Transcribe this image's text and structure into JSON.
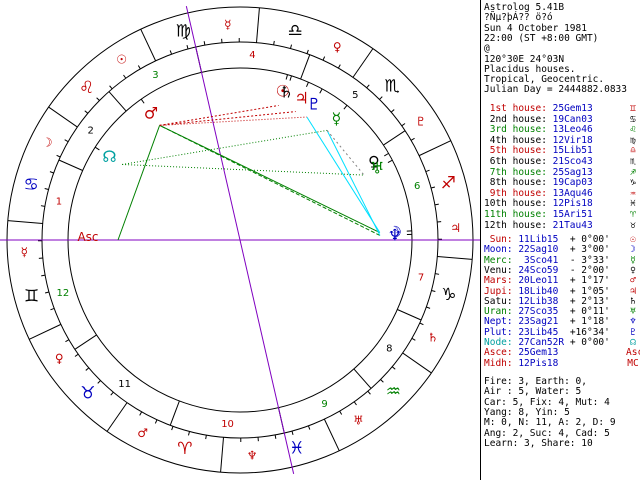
{
  "header": [
    "Astrolog 5.41B",
    "?Ñµ?þÁ?? ö?ó",
    "Sun 4 October 1981",
    "22:00 (ST +8:00 GMT)",
    "@",
    "120°30E 24°03N",
    "Placidus houses.",
    "Tropical, Geocentric.",
    "Julian Day = 2444882.0833"
  ],
  "houses": [
    {
      "label": "1st house:",
      "value": "25Gem13",
      "glyph": "♊",
      "color": "#c00000"
    },
    {
      "label": "2nd house:",
      "value": "19Can03",
      "glyph": "♋",
      "color": "#000000"
    },
    {
      "label": "3rd house:",
      "value": "13Leo46",
      "glyph": "♌",
      "color": "#008000"
    },
    {
      "label": "4th house:",
      "value": "12Vir18",
      "glyph": "♍",
      "color": "#000000"
    },
    {
      "label": "5th house:",
      "value": "15Lib51",
      "glyph": "♎",
      "color": "#c00000"
    },
    {
      "label": "6th house:",
      "value": "21Sco43",
      "glyph": "♏",
      "color": "#000000"
    },
    {
      "label": "7th house:",
      "value": "25Sag13",
      "glyph": "♐",
      "color": "#008000"
    },
    {
      "label": "8th house:",
      "value": "19Cap03",
      "glyph": "♑",
      "color": "#000000"
    },
    {
      "label": "9th house:",
      "value": "13Aqu46",
      "glyph": "♒",
      "color": "#c00000"
    },
    {
      "label": "10th house:",
      "value": "12Pis18",
      "glyph": "♓",
      "color": "#000000"
    },
    {
      "label": "11th house:",
      "value": "15Ari51",
      "glyph": "♈",
      "color": "#008000"
    },
    {
      "label": "12th house:",
      "value": "21Tau43",
      "glyph": "♉",
      "color": "#000000"
    }
  ],
  "planets": [
    {
      "name": "Sun:",
      "pos": "11Lib15",
      "speed": "+ 0°00'",
      "glyph": "☉",
      "color": "#c00000"
    },
    {
      "name": "Moon:",
      "pos": "22Sag10",
      "speed": "+ 3°00'",
      "glyph": "☽",
      "color": "#0000c0"
    },
    {
      "name": "Merc:",
      "pos": " 3Sco41",
      "speed": "- 3°33'",
      "glyph": "☿",
      "color": "#008000"
    },
    {
      "name": "Venu:",
      "pos": "24Sco59",
      "speed": "- 2°00'",
      "glyph": "♀",
      "color": "#000000"
    },
    {
      "name": "Mars:",
      "pos": "20Leo11",
      "speed": "+ 1°17'",
      "glyph": "♂",
      "color": "#c00000"
    },
    {
      "name": "Jupi:",
      "pos": "18Lib40",
      "speed": "+ 1°05'",
      "glyph": "♃",
      "color": "#c00000"
    },
    {
      "name": "Satu:",
      "pos": "12Lib38",
      "speed": "+ 2°13'",
      "glyph": "♄",
      "color": "#000000"
    },
    {
      "name": "Uran:",
      "pos": "27Sco35",
      "speed": "+ 0°11'",
      "glyph": "♅",
      "color": "#008000"
    },
    {
      "name": "Nept:",
      "pos": "23Sag21",
      "speed": "+ 1°18'",
      "glyph": "♆",
      "color": "#0000c0"
    },
    {
      "name": "Plut:",
      "pos": "23Lib45",
      "speed": "+16°34'",
      "glyph": "♇",
      "color": "#0000c0"
    },
    {
      "name": "Node:",
      "pos": "27Can52R",
      "speed": "+ 0°00'",
      "glyph": "☊",
      "color": "#00a0a0"
    },
    {
      "name": "Asce:",
      "pos": "25Gem13",
      "speed": "",
      "glyph": "Asc",
      "color": "#c00000"
    },
    {
      "name": "Midh:",
      "pos": "12Pis18",
      "speed": "",
      "glyph": "MC",
      "color": "#c00000"
    }
  ],
  "summary": [
    "Fire: 3, Earth: 0,",
    "Air : 5, Water: 5",
    "Car: 5, Fix: 4, Mut: 4",
    "Yang: 8, Yin: 5",
    "M: 0, N: 11, A: 2, D: 9",
    "Ang: 2, Suc: 4, Cad: 5",
    "Learn: 3, Share: 10"
  ],
  "wheel": {
    "signs": [
      {
        "glyph": "♈",
        "color": "#c00000"
      },
      {
        "glyph": "♉",
        "color": "#0000c0"
      },
      {
        "glyph": "♊",
        "color": "#000000"
      },
      {
        "glyph": "♋",
        "color": "#0000c0"
      },
      {
        "glyph": "♌",
        "color": "#c00000"
      },
      {
        "glyph": "♍",
        "color": "#000000"
      },
      {
        "glyph": "♎",
        "color": "#000000"
      },
      {
        "glyph": "♏",
        "color": "#000000"
      },
      {
        "glyph": "♐",
        "color": "#c00000"
      },
      {
        "glyph": "♑",
        "color": "#000000"
      },
      {
        "glyph": "♒",
        "color": "#008000"
      },
      {
        "glyph": "♓",
        "color": "#0000c0"
      }
    ],
    "rulers": [
      "♂",
      "♀",
      "☿",
      "☽",
      "☉",
      "☿",
      "♀",
      "♇",
      "♃",
      "♄",
      "♅",
      "♆"
    ],
    "house_numbers": [
      "1",
      "2",
      "3",
      "4",
      "5",
      "6",
      "7",
      "8",
      "9",
      "10",
      "11",
      "12"
    ],
    "asc_label": "Asc",
    "colors": {
      "red": "#c00000",
      "green": "#008000",
      "blue": "#0000c0",
      "cyan": "#00e0ff",
      "purple": "#8000c0",
      "gray": "#808080"
    }
  }
}
